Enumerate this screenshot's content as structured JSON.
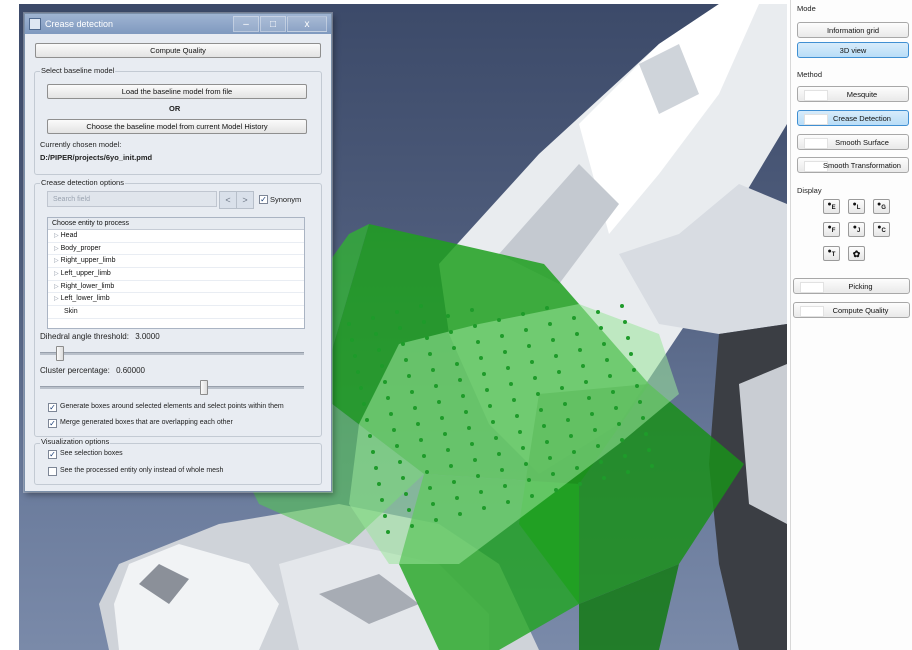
{
  "dialog": {
    "title": "Crease detection",
    "window_controls": {
      "minimize": "–",
      "maximize": "□",
      "close": "x"
    },
    "compute_quality": "Compute Quality",
    "baseline": {
      "group_title": "Select baseline model",
      "load_button": "Load the baseline model from file",
      "or_text": "OR",
      "choose_button": "Choose the baseline model from current Model History",
      "current_label": "Currently chosen model:",
      "current_path": "D:/PIPER/projects/6yo_init.pmd"
    },
    "options": {
      "group_title": "Crease detection options",
      "search_placeholder": "Search field",
      "prev": "<",
      "next": ">",
      "synonym_label": "Synonym",
      "synonym_checked": true,
      "entity_header": "Choose entity to process",
      "entities": [
        "Head",
        "Body_proper",
        "Right_upper_limb",
        "Left_upper_limb",
        "Right_lower_limb",
        "Left_lower_limb",
        "Skin"
      ],
      "dihedral_label": "Dihedral angle threshold:",
      "dihedral_value": "3.0000",
      "cluster_label": "Cluster percentage:",
      "cluster_value": "0.60000",
      "generate_boxes_label": "Generate boxes around selected elements and select points within them",
      "generate_boxes_checked": true,
      "merge_boxes_label": "Merge generated boxes that are overlapping each other",
      "merge_boxes_checked": true
    },
    "visualization": {
      "group_title": "Visualization options",
      "see_boxes_label": "See selection boxes",
      "see_boxes_checked": true,
      "processed_only_label": "See the processed entity only instead of whole mesh",
      "processed_only_checked": false
    }
  },
  "right_panel": {
    "mode_label": "Mode",
    "information_grid": "Information grid",
    "view_3d": "3D view",
    "method_label": "Method",
    "methods": [
      "Mesquite",
      "Crease Detection",
      "Smooth Surface",
      "Smooth Transformation"
    ],
    "active_method": "Crease Detection",
    "display_label": "Display",
    "display_buttons": [
      "E",
      "L",
      "G",
      "F",
      "J",
      "C",
      "T",
      "gear"
    ],
    "picking": "Picking",
    "compute_quality": "Compute Quality"
  },
  "colors": {
    "viewport_bg": "#4d5b7a",
    "selection_box": "#1fa01f",
    "point": "#1e9b2a",
    "active_button": "#b9ddf7"
  }
}
